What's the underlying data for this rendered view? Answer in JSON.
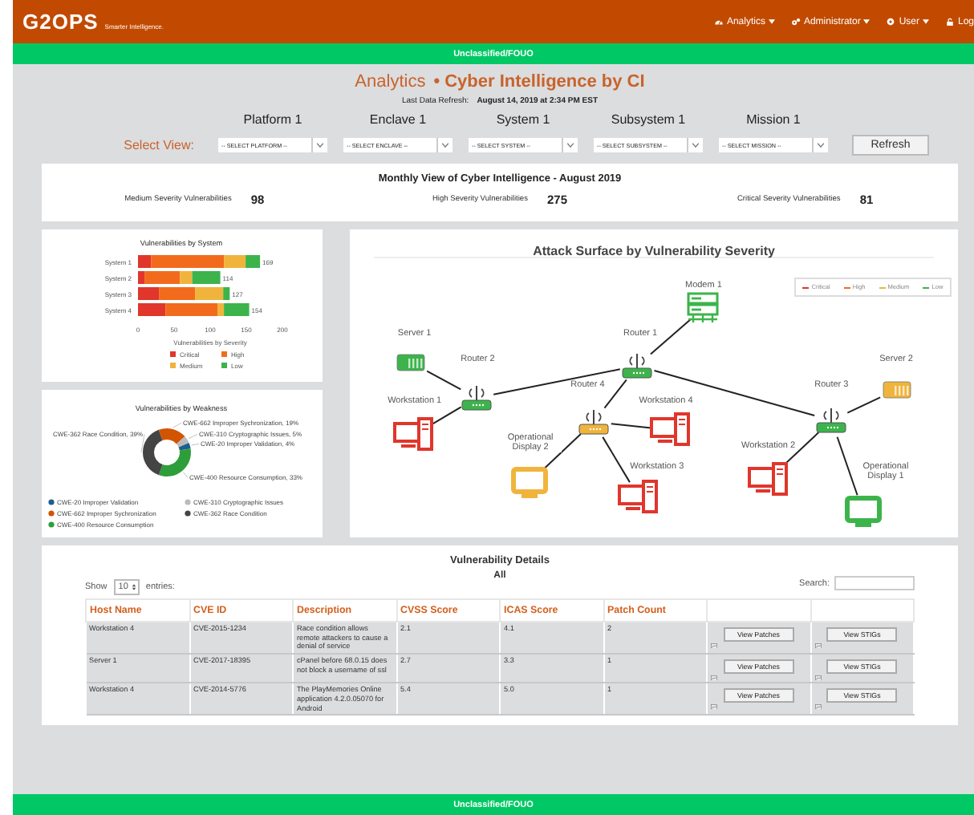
{
  "header": {
    "logo": "G2OPS",
    "tagline": "Smarter Intelligence.",
    "nav": [
      {
        "label": "Analytics",
        "kind": "analytics",
        "dropdown": true
      },
      {
        "label": "Administrator",
        "kind": "admin",
        "dropdown": true
      },
      {
        "label": "User",
        "kind": "user",
        "dropdown": true
      },
      {
        "label": "Log",
        "kind": "logout",
        "dropdown": false
      }
    ]
  },
  "classification_top": "Unclassified/FOUO",
  "title": {
    "section": "Analytics",
    "name": "• Cyber Intelligence by CI"
  },
  "refresh": {
    "label": "Last Data Refresh:",
    "value": "August 14, 2019 at 2:34 PM EST"
  },
  "filters": {
    "label": "Select View:",
    "button": "Refresh",
    "columns": [
      {
        "heading": "Platform 1",
        "select": "-- SELECT PLATFORM --"
      },
      {
        "heading": "Enclave 1",
        "select": "-- SELECT ENCLAVE --"
      },
      {
        "heading": "System 1",
        "select": "-- SELECT SYSTEM --"
      },
      {
        "heading": "Subsystem 1",
        "select": "-- SELECT SUBSYSTEM --"
      },
      {
        "heading": "Mission 1",
        "select": "-- SELECT MISSION --"
      }
    ]
  },
  "summary": {
    "title": "Monthly View of Cyber Intelligence - August 2019",
    "stats": [
      {
        "label": "Medium Severity Vulnerabilities",
        "value": "98"
      },
      {
        "label": "High Severity Vulnerabilities",
        "value": "275"
      },
      {
        "label": "Critical Severity Vulnerabilities",
        "value": "81"
      }
    ]
  },
  "system_chart": {
    "chart_data": {
      "type": "bar",
      "orientation": "horizontal",
      "stacked": true,
      "legend": "bottom",
      "title": "Vulnerabilities by System",
      "xlabel": "Vulnerabilities by Severity",
      "categories": [
        "System 1",
        "System 2",
        "System 3",
        "System 4"
      ],
      "xticks": [
        0,
        50,
        100,
        150,
        200
      ],
      "xlim": [
        0,
        200
      ],
      "series": [
        {
          "name": "Critical",
          "color": "#e0362c",
          "values": [
            18,
            9,
            29,
            38
          ]
        },
        {
          "name": "High",
          "color": "#f26b1d",
          "values": [
            101,
            49,
            50,
            72
          ]
        },
        {
          "name": "Medium",
          "color": "#f0b43c",
          "values": [
            30,
            17,
            39,
            9
          ]
        },
        {
          "name": "Low",
          "color": "#3cb44b",
          "values": [
            20,
            39,
            9,
            35
          ]
        }
      ],
      "value_labels": [
        "169",
        "114",
        "127",
        "154"
      ]
    }
  },
  "weakness_chart": {
    "chart_data": {
      "type": "donut",
      "legend": "bottom",
      "title": "Vulnerabilities by Weakness",
      "categories": [
        "CWE-662 Improper Sychronization",
        "CWE-310 Cryptographic Issues",
        "CWE-20 Improper Validation",
        "CWE-400 Resource Consumption",
        "CWE-362 Race Condition"
      ],
      "values": [
        19,
        5,
        4,
        33,
        39
      ],
      "colors": [
        "#d35400",
        "#bbbbbb",
        "#1f5f8b",
        "#2e9e3a",
        "#444444"
      ],
      "value_labels": [
        "CWE-662 Improper Sychronization, 19%",
        "CWE-310 Cryptographic Issues, 5%",
        "CWE-20 Improper Validation, 4%",
        "CWE-400 Resource Consumption, 33%",
        "CWE-362 Race Condition, 39%"
      ]
    }
  },
  "network": {
    "title": "Attack Surface by Vulnerability Severity",
    "legend": [
      {
        "label": "Critical",
        "color": "#e0362c"
      },
      {
        "label": "High",
        "color": "#f26b1d"
      },
      {
        "label": "Medium",
        "color": "#f0b43c"
      },
      {
        "label": "Low",
        "color": "#3cb44b"
      }
    ],
    "nodes": [
      {
        "label": "Modem 1",
        "kind": "modem",
        "color": "#3cb44b"
      },
      {
        "label": "Router 1",
        "kind": "router",
        "color": "#3cb44b"
      },
      {
        "label": "Server 1",
        "kind": "server",
        "color": "#3cb44b"
      },
      {
        "label": "Router 2",
        "kind": "router",
        "color": "#3cb44b"
      },
      {
        "label": "Workstation 1",
        "kind": "workstation",
        "color": "#e0362c"
      },
      {
        "label": "Router 4",
        "kind": "router",
        "color": "#f0b43c"
      },
      {
        "label": "Workstation 4",
        "kind": "workstation",
        "color": "#e0362c"
      },
      {
        "label": "Operational Display 2",
        "kind": "display",
        "color": "#f0b43c"
      },
      {
        "label": "Workstation 3",
        "kind": "workstation",
        "color": "#e0362c"
      },
      {
        "label": "Router 3",
        "kind": "router",
        "color": "#3cb44b"
      },
      {
        "label": "Server 2",
        "kind": "server",
        "color": "#f0b43c"
      },
      {
        "label": "Workstation 2",
        "kind": "workstation",
        "color": "#e0362c"
      },
      {
        "label": "Operational Display 1",
        "kind": "display",
        "color": "#3cb44b"
      }
    ]
  },
  "table": {
    "title": "Vulnerability Details",
    "subtitle": "All",
    "show_label": "Show",
    "page_size": "10",
    "entries_label": "entries:",
    "search_label": "Search:",
    "columns": [
      "Host Name",
      "CVE ID",
      "Description",
      "CVSS Score",
      "ICAS Score",
      "Patch Count"
    ],
    "rows": [
      {
        "cells": [
          "Workstation 4",
          "CVE-2015-1234",
          "Race condition allows remote attackers to cause a denial of service",
          "2.1",
          "4.1",
          "2"
        ],
        "actions": [
          "View Patches",
          "View STIGs"
        ]
      },
      {
        "cells": [
          "Server 1",
          "CVE-2017-18395",
          "cPanel before 68.0.15 does not block a username of ssl",
          "2.7",
          "3.3",
          "1"
        ],
        "actions": [
          "View Patches",
          "View STIGs"
        ]
      },
      {
        "cells": [
          "Workstation 4",
          "CVE-2014-5776",
          "The PlayMemories Online application 4.2.0.05070 for Android",
          "5.4",
          "5.0",
          "1"
        ],
        "actions": [
          "View Patches",
          "View STIGs"
        ]
      }
    ]
  },
  "classification_bottom": "Unclassified/FOUO"
}
